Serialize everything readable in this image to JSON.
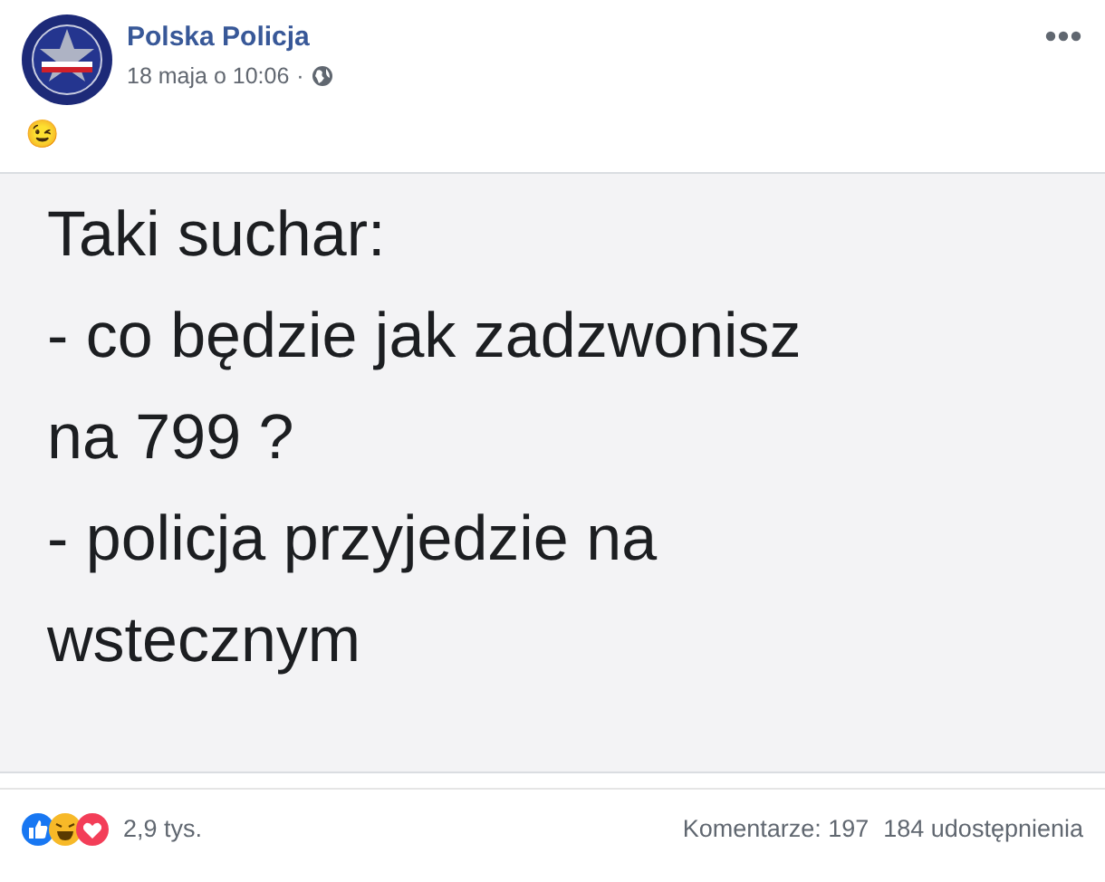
{
  "post": {
    "author": "Polska Policja",
    "time": "18 maja o 10:06",
    "separator": "·",
    "emoji": "😉",
    "image_text": [
      "Taki suchar:",
      "- co będzie jak zadzwonisz",
      "na 799 ?",
      "- policja przyjedzie na",
      "wstecznym"
    ],
    "reactions_count": "2,9 tys.",
    "comments": "Komentarze: 197",
    "shares": "184 udostępnienia"
  }
}
